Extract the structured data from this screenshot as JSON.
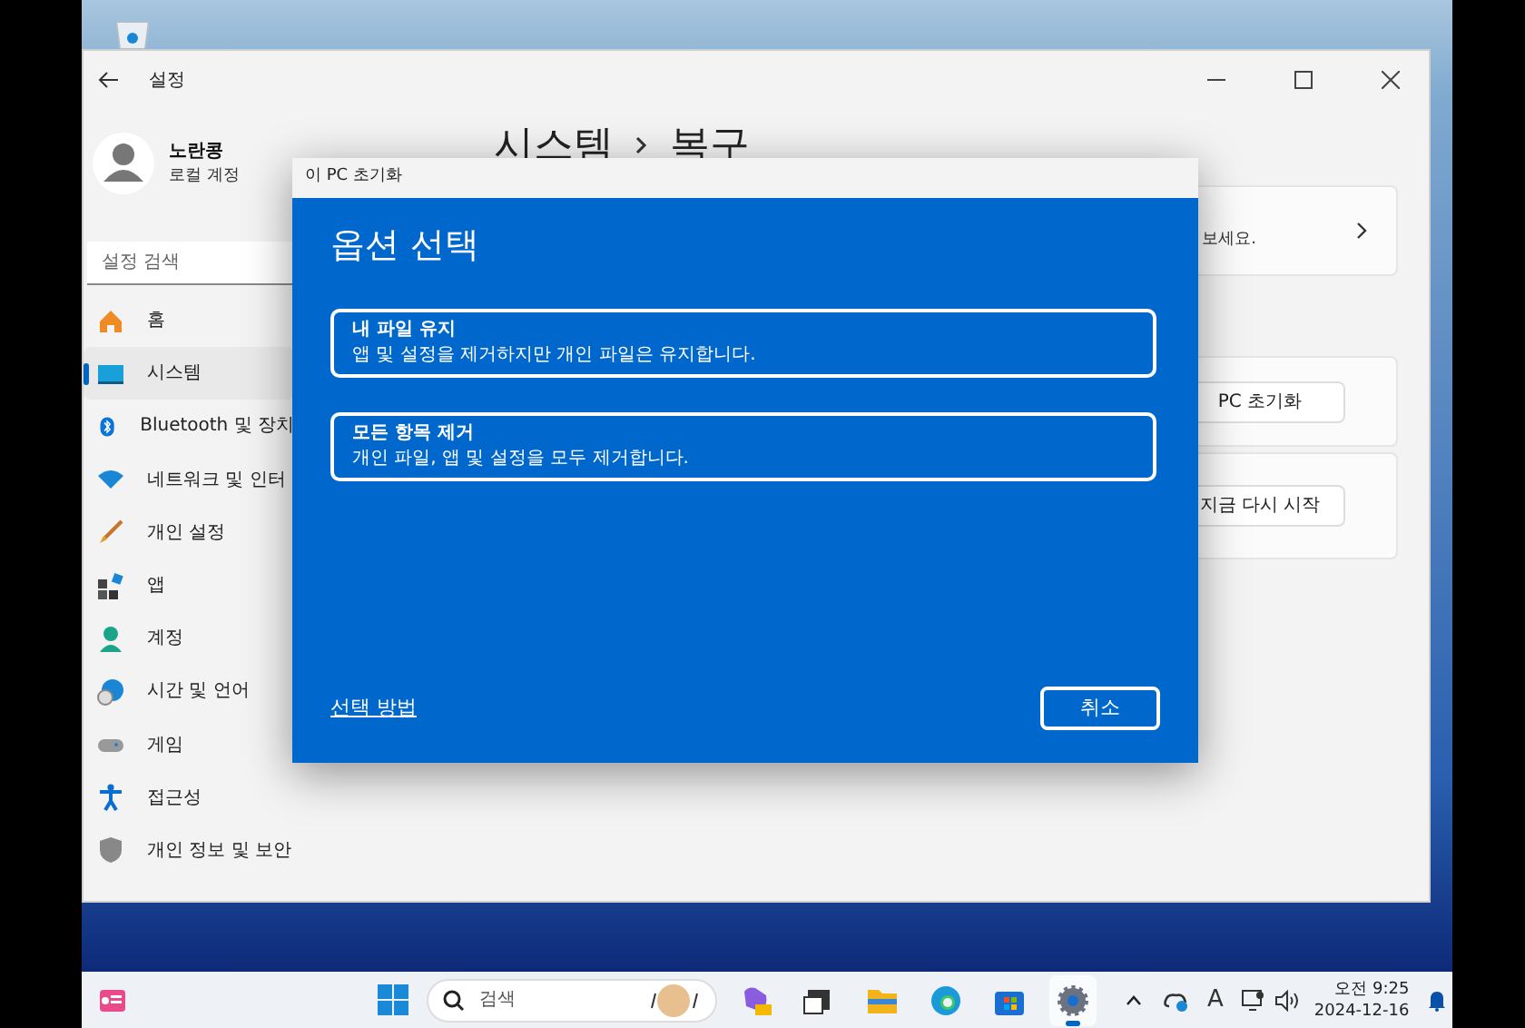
{
  "settings_window": {
    "title": "설정",
    "user": {
      "name": "노란콩",
      "account": "로컬 계정"
    },
    "search": {
      "placeholder": "설정 검색"
    },
    "nav": [
      {
        "label": "홈",
        "selected": false
      },
      {
        "label": "시스템",
        "selected": true
      },
      {
        "label": "Bluetooth 및 장치",
        "selected": false
      },
      {
        "label": "네트워크 및 인터",
        "selected": false
      },
      {
        "label": "개인 설정",
        "selected": false
      },
      {
        "label": "앱",
        "selected": false
      },
      {
        "label": "계정",
        "selected": false
      },
      {
        "label": "시간 및 언어",
        "selected": false
      },
      {
        "label": "게임",
        "selected": false
      },
      {
        "label": "접근성",
        "selected": false
      },
      {
        "label": "개인 정보 및 보안",
        "selected": false
      }
    ],
    "breadcrumb": [
      "시스템",
      "복구"
    ],
    "cards": [
      {
        "kind": "link",
        "text": "보세요."
      },
      {
        "kind": "button",
        "text": "PC 초기화"
      },
      {
        "kind": "button",
        "text": "지금 다시 시작"
      }
    ]
  },
  "dialog": {
    "title": "이 PC 초기화",
    "heading": "옵션 선택",
    "options": [
      {
        "title": "내 파일 유지",
        "description": "앱 및 설정을 제거하지만 개인 파일은 유지합니다."
      },
      {
        "title": "모든 항목 제거",
        "description": "개인 파일, 앱 및 설정을 모두 제거합니다."
      }
    ],
    "link": "선택 방법",
    "cancel": "취소"
  },
  "taskbar": {
    "search": {
      "placeholder": "검색"
    },
    "apps": [
      {
        "kind": "copilot",
        "selected": false
      },
      {
        "kind": "taskview",
        "selected": false
      },
      {
        "kind": "explorer",
        "selected": false
      },
      {
        "kind": "edge",
        "selected": false
      },
      {
        "kind": "store",
        "selected": false
      },
      {
        "kind": "settings",
        "selected": true
      }
    ],
    "ime": "A",
    "time": "오전 9:25",
    "date": "2024-12-16"
  }
}
